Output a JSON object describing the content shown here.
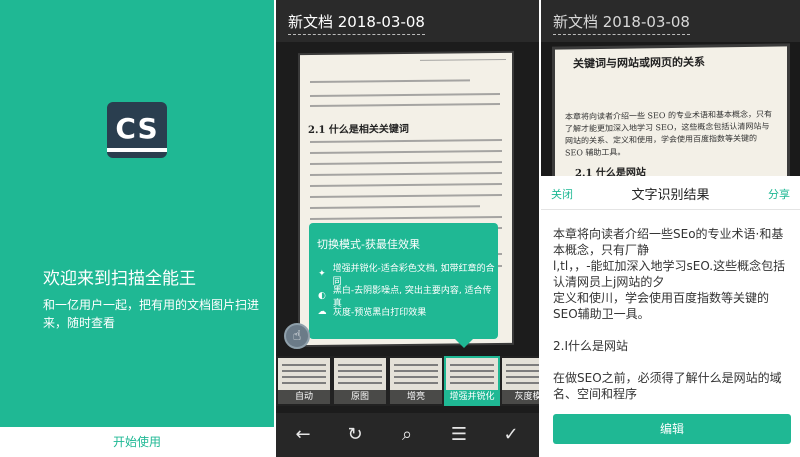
{
  "welcome": {
    "logo_text": "CS",
    "headline": "欢迎来到扫描全能王",
    "description": "和一亿用户一起，把有用的文档图片扫进来，随时查看",
    "start_button": "开始使用",
    "brand_color": "#1fb894"
  },
  "editor": {
    "doc_title": "新文档 2018-03-08",
    "page": {
      "running_head": "第1章 关键词与网站或网页的关系",
      "heading": "2.1 什么是相关关键词"
    },
    "tip": {
      "heading": "切换模式-获最佳效果",
      "items": [
        {
          "icon": "sparkle-icon",
          "glyph": "✦",
          "label": "增强并锐化-适合彩色文档, 如带红章的合同"
        },
        {
          "icon": "contrast-icon",
          "glyph": "◐",
          "label": "黑白-去阴影噪点, 突出主要内容, 适合传真"
        },
        {
          "icon": "cloud-icon",
          "glyph": "☁",
          "label": "灰度-预览黑白打印效果"
        }
      ]
    },
    "filters": [
      {
        "label": "自动"
      },
      {
        "label": "原图"
      },
      {
        "label": "增亮"
      },
      {
        "label": "增强并锐化",
        "selected": true
      },
      {
        "label": "灰度模"
      }
    ],
    "tools": [
      {
        "icon": "back-arrow-icon",
        "glyph": "←"
      },
      {
        "icon": "rotate-icon",
        "glyph": "↻"
      },
      {
        "icon": "ocr-icon",
        "glyph": "⌕"
      },
      {
        "icon": "adjust-icon",
        "glyph": "☰"
      },
      {
        "icon": "check-icon",
        "glyph": "✓"
      }
    ]
  },
  "ocr": {
    "doc_title": "新文档 2018-03-08",
    "page_heading": "关键词与网站或网页的关系",
    "page_text": "本章将向读者介绍一些 SEO 的专业术语和基本概念，只有了解才能更加深入地学习 SEO，这些概念包括认清网站与网站的关系、定义和使用，学会使用百度指数等关键的 SEO 辅助工具。",
    "page_sub": "2.1 什么是网站",
    "close": "关闭",
    "title": "文字识别结果",
    "share": "分享",
    "result_text": "本章将向读者介绍一些SEo的专业术语·和基本概念，只有厂静\nl,tl，，-能虹加深入地学习sEO.这些概念包括认清网员上j网站的夕\n定义和使川，学会使用百度指数等关键的SEO辅助卫一具。\n\n2.I什么是网站\n\n在做SEO之前，必须得了解什么是网站的域名、空间和程序",
    "edit_button": "编辑"
  }
}
